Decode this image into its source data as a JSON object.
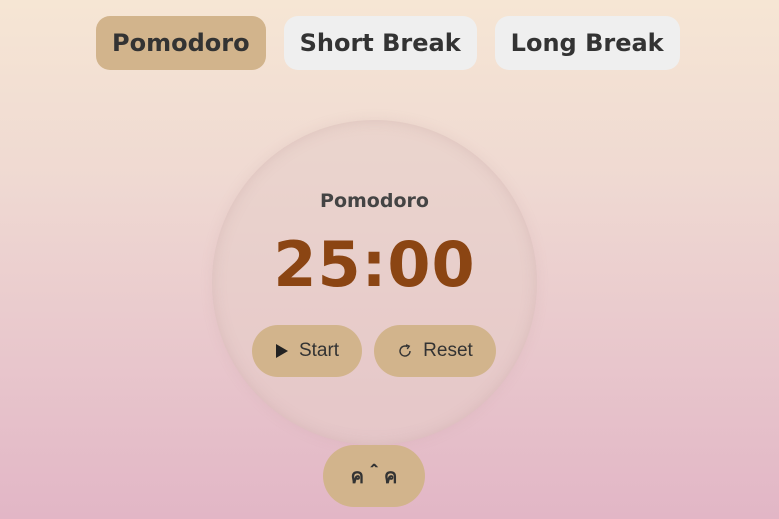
{
  "tabs": [
    {
      "label": "Pomodoro",
      "active": true
    },
    {
      "label": "Short Break",
      "active": false
    },
    {
      "label": "Long Break",
      "active": false
    }
  ],
  "timer": {
    "mode_label": "Pomodoro",
    "time": "25:00"
  },
  "controls": {
    "start_label": "Start",
    "start_icon": "play-icon",
    "reset_label": "Reset",
    "reset_icon": "refresh-icon"
  },
  "extra_button": {
    "label": "ค＾ค"
  },
  "colors": {
    "accent": "#d2b48c",
    "inactive_tab": "#efefef",
    "time_text": "#8b4513",
    "text": "#333333"
  }
}
